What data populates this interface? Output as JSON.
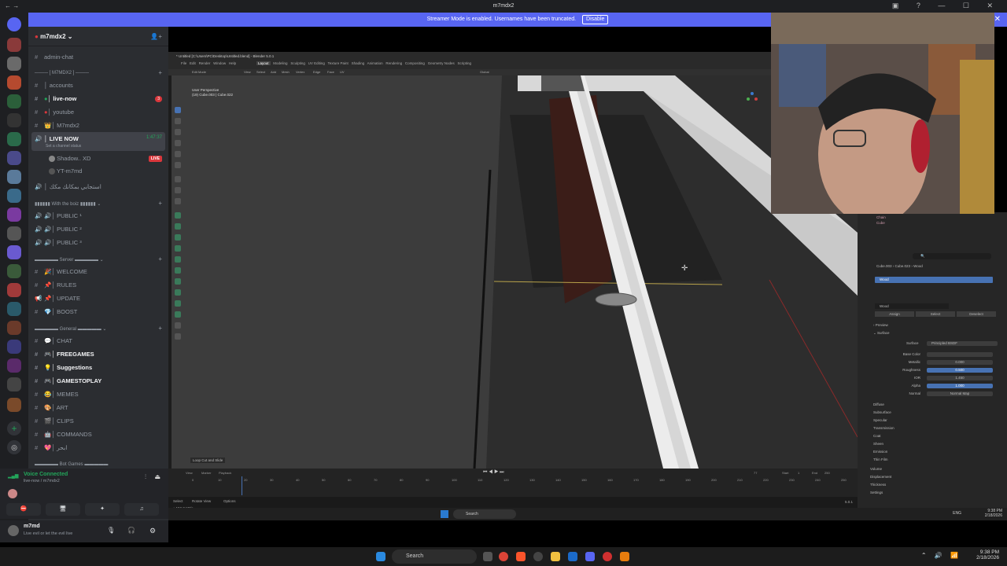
{
  "window": {
    "title": "m7mdx2",
    "controls": "▣ ? — ☐ ✕"
  },
  "banner": {
    "text": "Streamer Mode is enabled. Usernames have been truncated.",
    "button": "Disable"
  },
  "server": {
    "name": "m7mdx2"
  },
  "channels": {
    "admin": "admin-chat",
    "cat1": "──── [ M7MDX2 ] ────",
    "accounts": "accounts",
    "live_now": "live-now",
    "live_badge_count": "3",
    "youtube": "youtube",
    "m7mdx2": "M7mdx2",
    "voice_live": "LIVE NOW",
    "voice_time": "1:47:37",
    "voice_status": "Set a channel status",
    "member1": "Shadow.. XD",
    "member1_badge": "LIVE",
    "member2": "YT-m7md",
    "arabic_channel": "استجابي بمكانك مكك",
    "cat2": "With the boiz",
    "public1": "PUBLIC ¹",
    "public2": "PUBLIC ²",
    "public3": "PUBLIC ³",
    "cat3": "Server",
    "welcome": "WELCOME",
    "rules": "RULES",
    "update": "UPDATE",
    "boost": "BOOST",
    "cat4": "General",
    "chat": "CHAT",
    "freegames": "FREEGAMES",
    "suggestions": "Suggestions",
    "gamestoplay": "GAMESTOPLAY",
    "memes": "MEMES",
    "art": "ART",
    "clips": "CLIPS",
    "commands": "COMMANDS",
    "arabic2": "ابحر",
    "cat5": "Bot Games"
  },
  "voice_panel": {
    "status": "Voice Connected",
    "sub": "live-now / m7mdx2"
  },
  "user_panel": {
    "name": "m7md",
    "status": "Live evil or let the evil live"
  },
  "blender": {
    "title": "* Untitled [C:\\Users\\PC\\Desktop\\Untitled.blend] - Blender 5.0.1",
    "menus": [
      "File",
      "Edit",
      "Render",
      "Window",
      "Help"
    ],
    "workspaces": [
      "Layout",
      "Modeling",
      "Sculpting",
      "UV Editing",
      "Texture Paint",
      "Shading",
      "Animation",
      "Rendering",
      "Compositing",
      "Geometry Nodes",
      "Scripting"
    ],
    "mode": "Edit Mode",
    "header_items": [
      "View",
      "Select",
      "Add",
      "Mesh",
      "Vertex",
      "Edge",
      "Face",
      "UV"
    ],
    "transform": "Global",
    "viewport_label": "User Perspective",
    "viewport_sub": "(19) Cube.003 | Cube.022",
    "operator_panel": "Loop Cut and Slide",
    "timeline_menus": [
      "View",
      "Marker",
      "Playback"
    ],
    "frame_current": "77",
    "start_label": "Start",
    "start": "1",
    "end_label": "End",
    "end": "250",
    "frame_ticks": [
      "0",
      "10",
      "20",
      "30",
      "40",
      "50",
      "60",
      "70",
      "80",
      "90",
      "100",
      "110",
      "120",
      "130",
      "140",
      "150",
      "160",
      "170",
      "180",
      "190",
      "200",
      "210",
      "220",
      "230",
      "240",
      "250"
    ],
    "status_left": "Select",
    "status_mid": "Rotate View",
    "status_right": "Options",
    "net": "↑ 152.3 KB/s",
    "net2": "↓ 17.9 KB/s",
    "version": "5.0.1"
  },
  "properties": {
    "object1": "Cube.003",
    "object2": "Cube.023",
    "material_path": "Wood",
    "slot": "Wood",
    "material": "Wood",
    "assign": "Assign",
    "select": "Select",
    "deselect": "Deselect",
    "preview": "Preview",
    "surface": "Surface",
    "surface_label": "Surface",
    "surface_value": "Principled BSDF",
    "rows": [
      {
        "label": "Base Color",
        "value": ""
      },
      {
        "label": "Metallic",
        "value": "0.000"
      },
      {
        "label": "Roughness",
        "value": "0.500"
      },
      {
        "label": "IOR",
        "value": "1.450"
      },
      {
        "label": "Alpha",
        "value": "1.000"
      },
      {
        "label": "Normal",
        "value": "Normal Map"
      }
    ],
    "sections": [
      "Diffuse",
      "Subsurface",
      "Specular",
      "Transmission",
      "Coat",
      "Sheen",
      "Emission",
      "Thin Film"
    ],
    "bottom": [
      "Volume",
      "Displacement",
      "Thickness",
      "Settings"
    ],
    "outliner": [
      "Chain",
      "Cube"
    ]
  },
  "inner_taskbar": {
    "search": "Search",
    "lang": "ENG",
    "time": "9:38 PM",
    "date": "2/18/2026"
  },
  "taskbar": {
    "search": "Search",
    "time": "9:38 PM",
    "date": "2/18/2026"
  }
}
